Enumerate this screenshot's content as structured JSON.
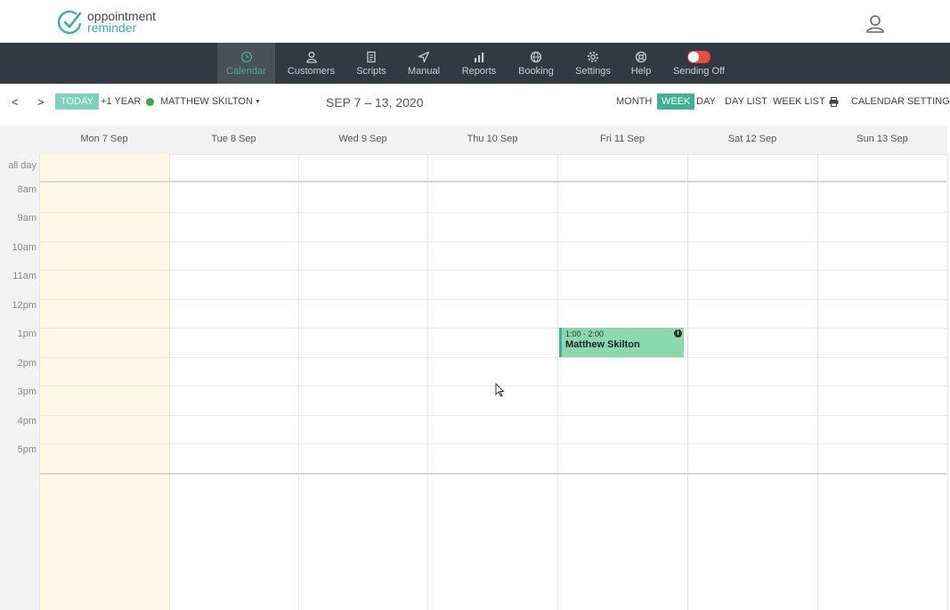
{
  "brand": {
    "line1": "oppointment",
    "line2": "reminder",
    "accent": "#3fb094"
  },
  "header": {
    "user_icon": "user-icon"
  },
  "nav": {
    "items": [
      {
        "label": "Calendar",
        "icon": "clock-icon",
        "active": true
      },
      {
        "label": "Customers",
        "icon": "person-icon"
      },
      {
        "label": "Scripts",
        "icon": "document-icon"
      },
      {
        "label": "Manual",
        "icon": "send-icon"
      },
      {
        "label": "Reports",
        "icon": "bar-chart-icon"
      },
      {
        "label": "Booking",
        "icon": "globe-icon"
      },
      {
        "label": "Settings",
        "icon": "gear-icon"
      },
      {
        "label": "Help",
        "icon": "lifebuoy-icon"
      },
      {
        "label": "Sending Off",
        "icon": "toggle-switch",
        "toggle_on": false,
        "toggle_color": "#e84d3d"
      }
    ]
  },
  "toolbar": {
    "prev": "<",
    "next": ">",
    "today": "TODAY",
    "plus_year": "+1 YEAR",
    "staff": "MATTHEW SKILTON",
    "staff_status_color": "#38a74a",
    "range": "SEP 7 – 13, 2020",
    "views": {
      "month": "MONTH",
      "week": "WEEK",
      "day": "DAY",
      "day_list": "DAY LIST",
      "week_list": "WEEK LIST"
    },
    "active_view": "WEEK",
    "print_icon": "print-icon",
    "settings": "CALENDAR SETTINGS"
  },
  "calendar": {
    "days": [
      "Mon 7 Sep",
      "Tue 8 Sep",
      "Wed 9 Sep",
      "Thu 10 Sep",
      "Fri 11 Sep",
      "Sat 12 Sep",
      "Sun 13 Sep"
    ],
    "today_index": 0,
    "all_day_label": "all day",
    "times": [
      "8am",
      "9am",
      "10am",
      "11am",
      "12pm",
      "1pm",
      "2pm",
      "3pm",
      "4pm",
      "5pm"
    ],
    "events": [
      {
        "day": "Fri 11 Sep",
        "time": "1:00 - 2:00",
        "title": "Matthew Skilton",
        "info_icon": "info-icon"
      }
    ]
  }
}
